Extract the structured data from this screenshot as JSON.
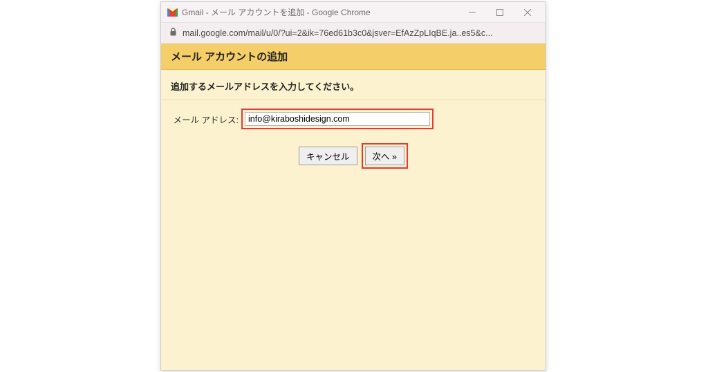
{
  "window": {
    "title": "Gmail - メール アカウントを追加 - Google Chrome"
  },
  "addressbar": {
    "url": "mail.google.com/mail/u/0/?ui=2&ik=76ed61b3c0&jsver=EfAzZpLIqBE.ja..es5&c..."
  },
  "page": {
    "header": "メール アカウントの追加",
    "instruction": "追加するメールアドレスを入力してください。",
    "email_label": "メール アドレス:",
    "email_value": "info@kiraboshidesign.com",
    "cancel_label": "キャンセル",
    "next_label": "次へ »"
  }
}
